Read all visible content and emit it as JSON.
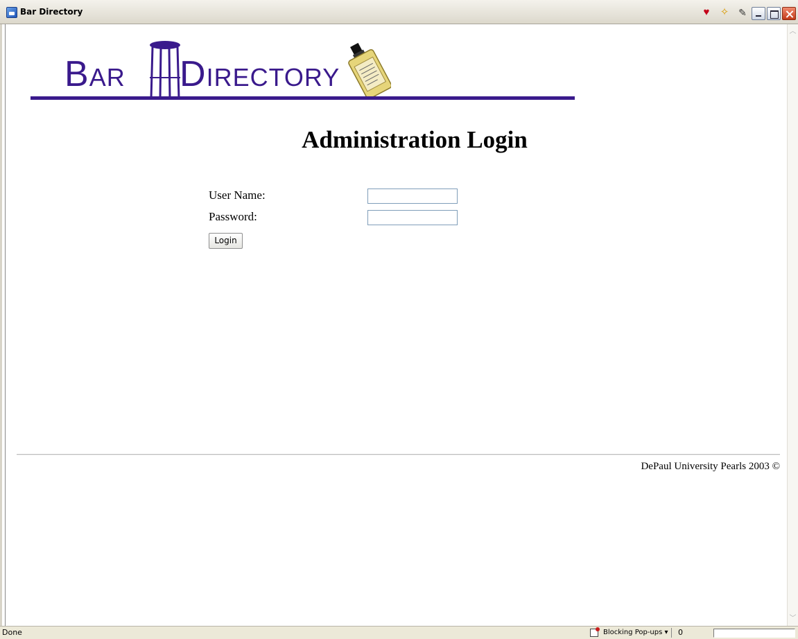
{
  "window": {
    "title": "Bar Directory",
    "icons": [
      "heart-icon",
      "sparkle-icon",
      "notepad-icon"
    ]
  },
  "logo": {
    "bar_initial": "B",
    "bar_rest": "AR",
    "dir_initial": "D",
    "dir_rest": "IRECTORY",
    "color": "#3a1a8c"
  },
  "page": {
    "title": "Administration Login"
  },
  "form": {
    "username_label": "User Name:",
    "username_value": "",
    "password_label": "Password:",
    "password_value": "",
    "login_label": "Login"
  },
  "footer": {
    "text": "DePaul University Pearls 2003 ©"
  },
  "statusbar": {
    "status": "Done",
    "popup_label": "Blocking Pop-ups ▾",
    "popup_count": "0"
  }
}
